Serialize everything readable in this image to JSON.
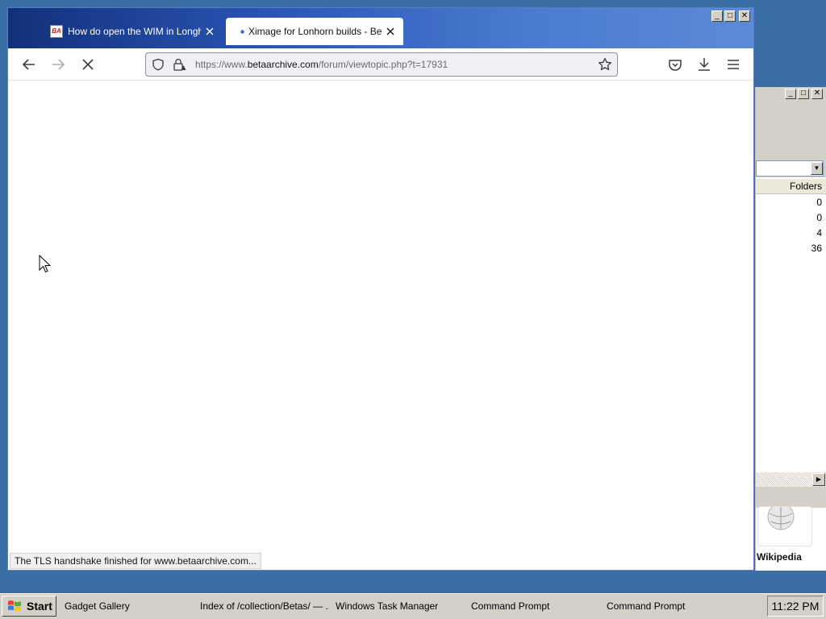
{
  "browser": {
    "tabs": [
      {
        "label": "How do open the WIM in Longhorn",
        "favicon_text": "BA",
        "active": false
      },
      {
        "label": "Ximage for Lonhorn builds - BetaArchive",
        "active": true
      }
    ],
    "url": {
      "prefix": "https://www.",
      "domain": "betaarchive.com",
      "path": "/forum/viewtopic.php?t=17931"
    },
    "status_text": "The TLS handshake finished for www.betaarchive.com...",
    "window_controls": {
      "minimize": "_",
      "maximize": "□",
      "close": "✕"
    }
  },
  "background_window": {
    "column_header": "Folders",
    "rows": [
      "0",
      "0",
      "4",
      "36"
    ],
    "gadget_label": "Wikipedia"
  },
  "taskbar": {
    "start_label": "Start",
    "items": [
      "Gadget Gallery",
      "Index of /collection/Betas/ — ...",
      "Windows Task Manager",
      "Command Prompt",
      "Command Prompt"
    ],
    "clock": "11:22 PM"
  },
  "colors": {
    "titlebar_start": "#12307a",
    "titlebar_end": "#5d8ad6",
    "accent_dot": "#3b63e6",
    "taskbar": "#d4d0c8"
  }
}
